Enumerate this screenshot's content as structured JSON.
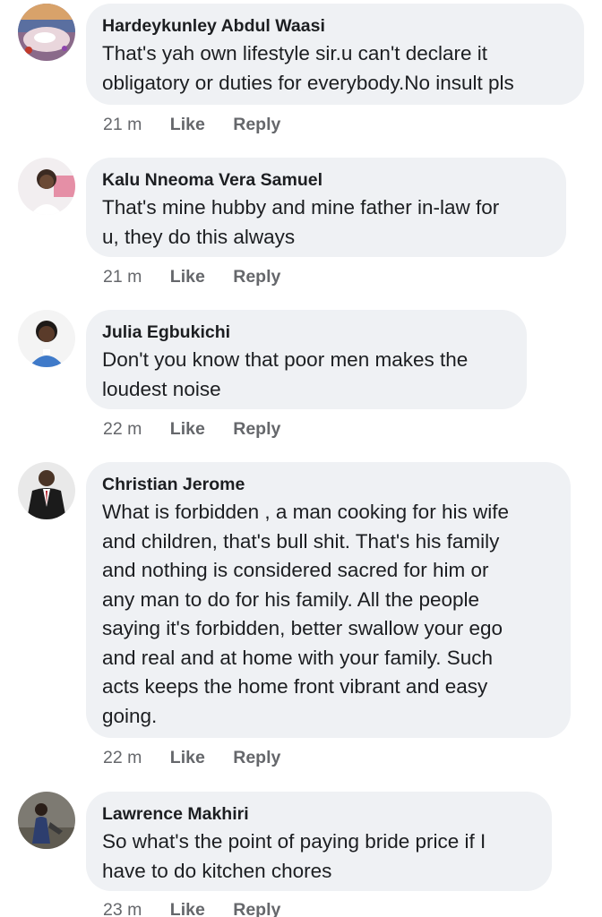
{
  "comments": [
    {
      "author": "Hardeykunley Abdul Waasi",
      "lines": [
        "That's yah own lifestyle sir.u can't declare it",
        "obligatory or duties for everybody.No insult pls"
      ],
      "time": "21 m",
      "like": "Like",
      "reply": "Reply"
    },
    {
      "author": "Kalu Nneoma Vera Samuel",
      "lines": [
        "That's mine hubby and mine father in-law for",
        "u, they do this always"
      ],
      "time": "21 m",
      "like": "Like",
      "reply": "Reply"
    },
    {
      "author": "Julia Egbukichi",
      "lines": [
        "Don't you know that poor men makes the",
        "loudest noise"
      ],
      "time": "22 m",
      "like": "Like",
      "reply": "Reply"
    },
    {
      "author": "Christian Jerome",
      "lines": [
        "What is forbidden , a man cooking for his wife",
        "and children, that's bull shit. That's his family",
        "and nothing is considered sacred for him or",
        "any man to do for his family. All the people",
        "saying it's forbidden, better swallow your ego",
        "and real and at home with your family. Such",
        "acts keeps the home front vibrant and easy",
        "going."
      ],
      "time": "22 m",
      "like": "Like",
      "reply": "Reply"
    },
    {
      "author": "Lawrence Makhiri",
      "lines": [
        "So what's the point of paying bride price if I",
        "have to do kitchen chores"
      ],
      "time": "23 m",
      "like": "Like",
      "reply": "Reply"
    }
  ],
  "colors": {
    "bubble_bg": "#eff1f4",
    "text": "#1c1e21",
    "meta": "#65676b"
  },
  "icons": {
    "avatar": "user-photo-avatar"
  }
}
